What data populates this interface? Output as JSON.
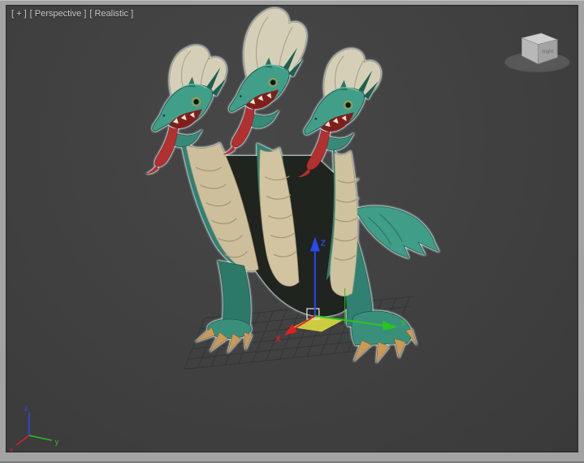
{
  "viewport": {
    "menus": {
      "general": "[ + ]",
      "pov": "[ Perspective ]",
      "shading": "[ Realistic ]"
    }
  },
  "gizmo": {
    "x_label": "X",
    "y_label": "Y",
    "z_label": "Z"
  },
  "world_axis": {
    "x_label": "x",
    "y_label": "y",
    "z_label": "z"
  },
  "viewcube": {
    "face_label": "Right"
  },
  "colors": {
    "axis_x": "#e02020",
    "axis_y": "#27c522",
    "axis_z": "#2b49f0",
    "plane_handle": "#f0ed42",
    "selection_outline": "#e9f6fb",
    "viewport_bg": "#414141",
    "frame": "#a3a3a3",
    "label_text": "#cbcbcb",
    "grid_line": "#313336"
  }
}
